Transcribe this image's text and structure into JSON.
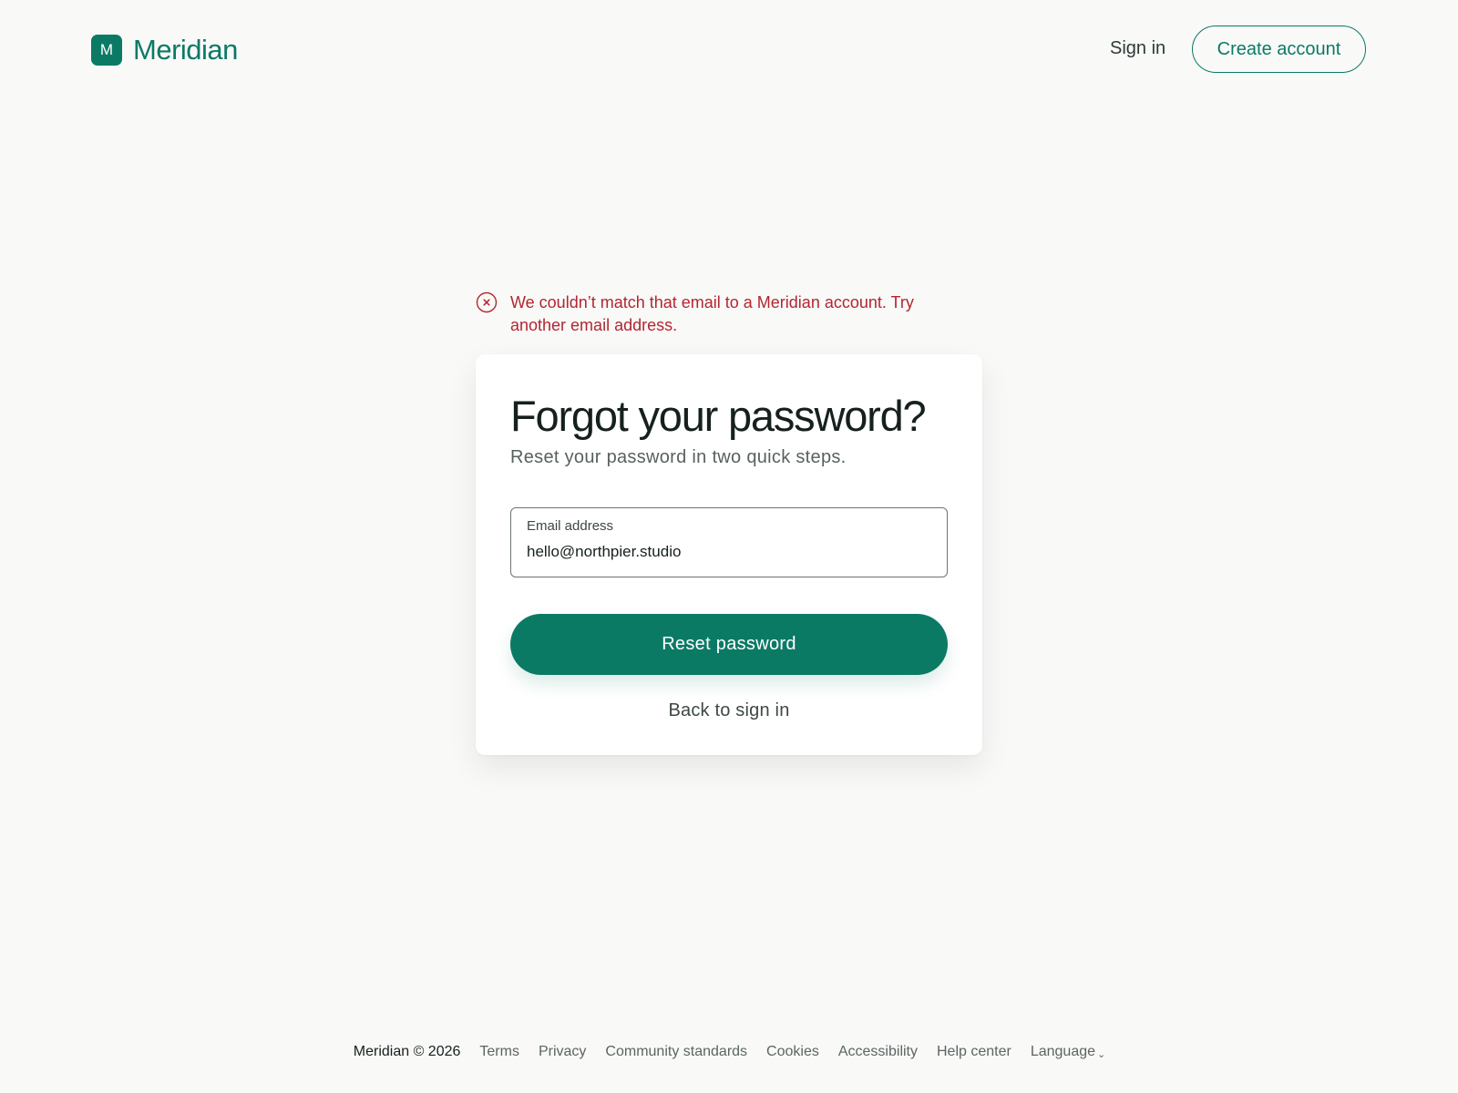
{
  "colors": {
    "brand": "#0b7a65",
    "error": "#b3262f",
    "background": "#f9f9f8"
  },
  "header": {
    "logo_letter": "M",
    "logo_text": "Meridian",
    "signin_label": "Sign in",
    "create_account_label": "Create account"
  },
  "error": {
    "icon": "error-circle-x-icon",
    "message": "We couldn’t match that email to a Meridian account. Try another email address."
  },
  "card": {
    "title": "Forgot your password?",
    "subtitle": "Reset your password in two quick steps.",
    "email_field": {
      "label": "Email address",
      "value": "hello@northpier.studio"
    },
    "reset_button_label": "Reset password",
    "back_link_label": "Back to sign in"
  },
  "footer": {
    "copyright": "Meridian © 2026",
    "links": [
      "Terms",
      "Privacy",
      "Community standards",
      "Cookies",
      "Accessibility",
      "Help center"
    ],
    "language_label": "Language",
    "language_icon": "chevron-down-icon"
  }
}
